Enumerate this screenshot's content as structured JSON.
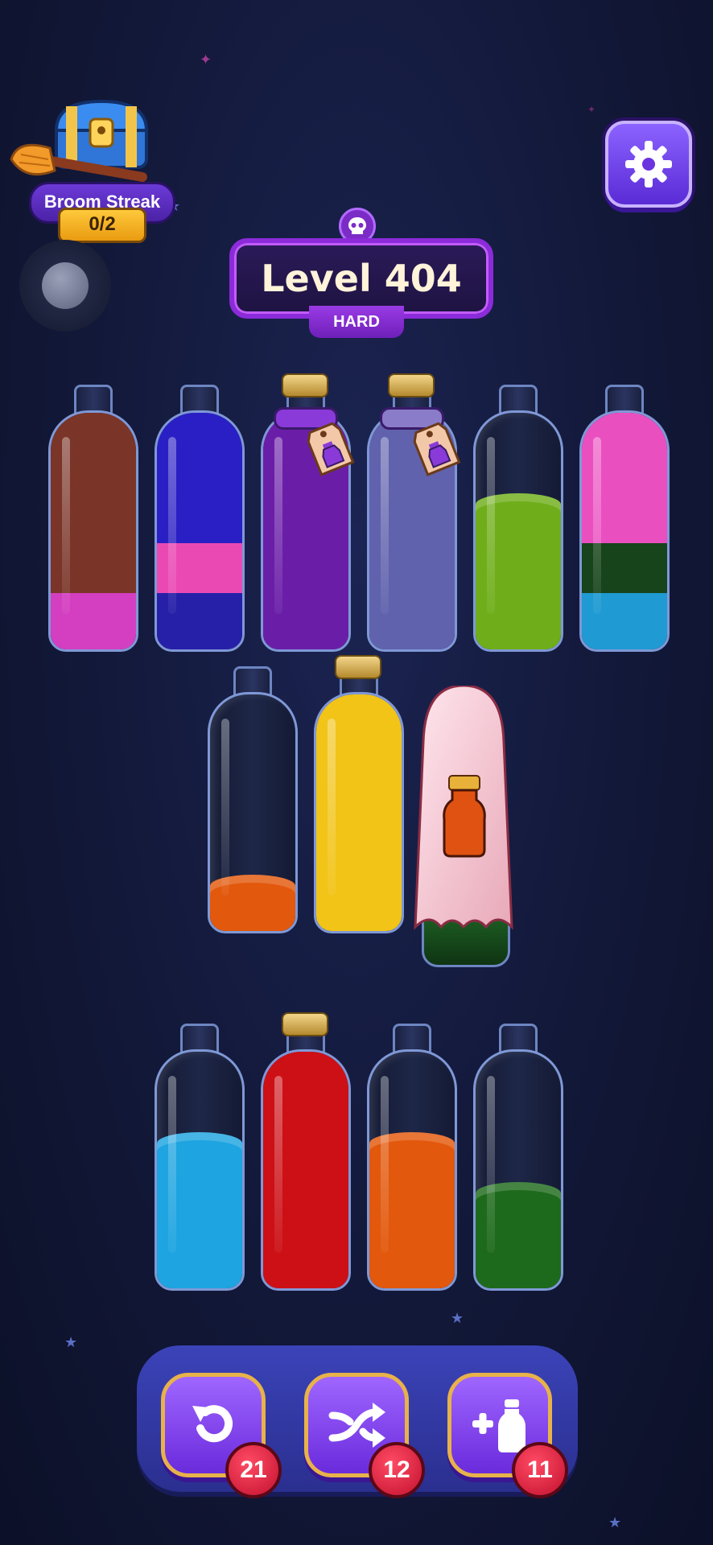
{
  "streak": {
    "label": "Broom Streak",
    "count": "0/2"
  },
  "level": {
    "title": "Level 404",
    "difficulty": "HARD"
  },
  "icons": {
    "settings": "gear-icon",
    "difficulty": "skull-icon",
    "undo": "undo-icon",
    "shuffle": "shuffle-icon",
    "add_bottle": "add-bottle-icon"
  },
  "bottles_row1": [
    {
      "layers": [
        "#d33fc0",
        "#7a3428",
        "#7a3428",
        "#7a3428"
      ],
      "empty_slots": 0,
      "corked": false
    },
    {
      "layers": [
        "#2620a8",
        "#ea49b4",
        "#2a1fc4",
        "#2a1fc4"
      ],
      "empty_slots": 0,
      "corked": false
    },
    {
      "layers": [
        "#6a1ea8",
        "#6a1ea8",
        "#6a1ea8",
        "#6a1ea8"
      ],
      "empty_slots": 0,
      "corked": true,
      "tag": "locked"
    },
    {
      "layers": [
        "#6062ad",
        "#6062ad",
        "#6062ad",
        "#6062ad"
      ],
      "empty_slots": 0,
      "corked": true,
      "tag": "locked"
    },
    {
      "layers": [
        "#6fae1a",
        "#6fae1a",
        "#6fae1a"
      ],
      "empty_slots": 1,
      "corked": false
    },
    {
      "layers": [
        "#1f9ad2",
        "#17441a",
        "#ea4fc0",
        "#ea4fc0"
      ],
      "empty_slots": 0,
      "corked": false
    }
  ],
  "bottles_row2": [
    {
      "layers": [
        "#e2580c"
      ],
      "empty_slots": 3,
      "corked": false
    },
    {
      "layers": [
        "#f2c418",
        "#f2c418",
        "#f2c418",
        "#f2c418"
      ],
      "empty_slots": 0,
      "corked": true
    },
    {
      "layers": [
        "#1c5a22"
      ],
      "empty_slots": 3,
      "corked": false,
      "covered": true
    }
  ],
  "bottles_row3": [
    {
      "layers": [
        "#1ea4e0",
        "#1ea4e0",
        "#1ea4e0"
      ],
      "empty_slots": 1,
      "corked": false
    },
    {
      "layers": [
        "#cc1016",
        "#cc1016",
        "#cc1016",
        "#cc1016"
      ],
      "empty_slots": 0,
      "corked": true
    },
    {
      "layers": [
        "#e2580c",
        "#e2580c",
        "#e2580c"
      ],
      "empty_slots": 1,
      "corked": false
    },
    {
      "layers": [
        "#1e6a1c",
        "#1e6a1c"
      ],
      "empty_slots": 2,
      "corked": false
    }
  ],
  "powerups": [
    {
      "name": "undo",
      "count": "21"
    },
    {
      "name": "shuffle",
      "count": "12"
    },
    {
      "name": "add-bottle",
      "count": "11"
    }
  ]
}
